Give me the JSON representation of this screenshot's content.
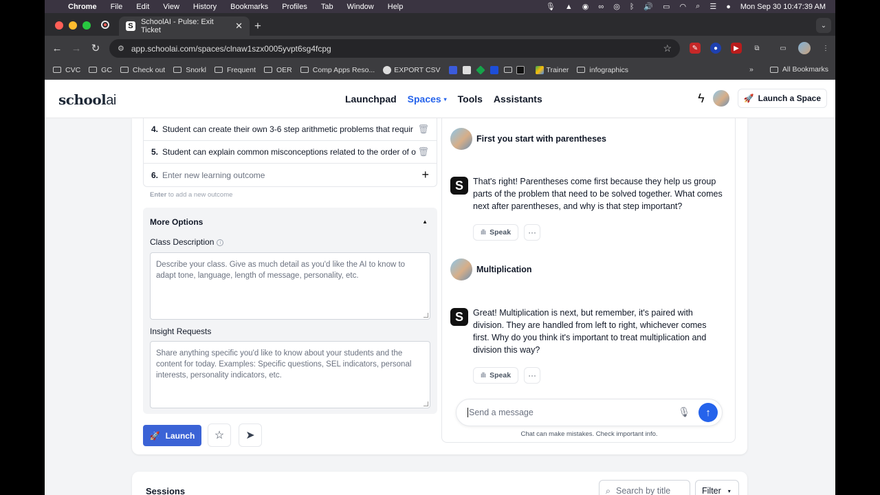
{
  "menubar": {
    "app": "Chrome",
    "items": [
      "File",
      "Edit",
      "View",
      "History",
      "Bookmarks",
      "Profiles",
      "Tab",
      "Window",
      "Help"
    ],
    "datetime": "Mon Sep 30  10:47:39 AM"
  },
  "browser": {
    "tab_title": "SchoolAI - Pulse: Exit Ticket",
    "tab_favicon": "S",
    "url": "app.schoolai.com/spaces/clnaw1szx0005yvpt6sg4fcpg",
    "bookmarks": [
      "CVC",
      "GC",
      "Check out",
      "Snorkl",
      "Frequent",
      "OER",
      "Comp Apps Reso...",
      "EXPORT CSV",
      "Trainer",
      "infographics"
    ],
    "all_bookmarks": "All Bookmarks"
  },
  "header": {
    "logo_main": "school",
    "logo_ai": "ai",
    "nav": [
      "Launchpad",
      "Spaces",
      "Tools",
      "Assistants"
    ],
    "launch_space": "Launch a Space"
  },
  "outcomes": [
    {
      "num": "4.",
      "text": "Student can create their own 3-6 step arithmetic problems that requir"
    },
    {
      "num": "5.",
      "text": "Student can explain common misconceptions related to the order of o"
    },
    {
      "num": "6.",
      "placeholder": "Enter new learning outcome"
    }
  ],
  "hint": {
    "key": "Enter",
    "rest": " to add a new outcome"
  },
  "more_options": {
    "title": "More Options",
    "class_description_label": "Class Description",
    "class_description_placeholder": "Describe your class. Give as much detail as you'd like the AI to know to adapt tone, language, length of message, personality, etc.",
    "insight_label": "Insight Requests",
    "insight_placeholder": "Share anything specific you'd like to know about your students and the content for today. Examples: Specific questions, SEL indicators, personal interests, personality indicators, etc."
  },
  "actions": {
    "launch": "Launch"
  },
  "chat": {
    "messages": [
      {
        "role": "user",
        "text": "First you start with parentheses"
      },
      {
        "role": "bot",
        "text": "That's right! Parentheses come first because they help us group parts of the problem that need to be solved together. What comes next after parentheses, and why is that step important?"
      },
      {
        "role": "user",
        "text": "Multiplication"
      },
      {
        "role": "bot",
        "text": "Great! Multiplication is next, but remember, it's paired with division. They are handled from left to right, whichever comes first. Why do you think it's important to treat multiplication and division this way?"
      }
    ],
    "speak_label": "Speak",
    "more_label": "···",
    "composer_placeholder": "Send a message",
    "disclaimer": "Chat can make mistakes. Check important info."
  },
  "sessions": {
    "title": "Sessions",
    "search_placeholder": "Search by title",
    "filter_label": "Filter"
  },
  "colors": {
    "accent": "#2563eb",
    "launch_button": "#3b63d6",
    "menubar": "#3a3441"
  }
}
